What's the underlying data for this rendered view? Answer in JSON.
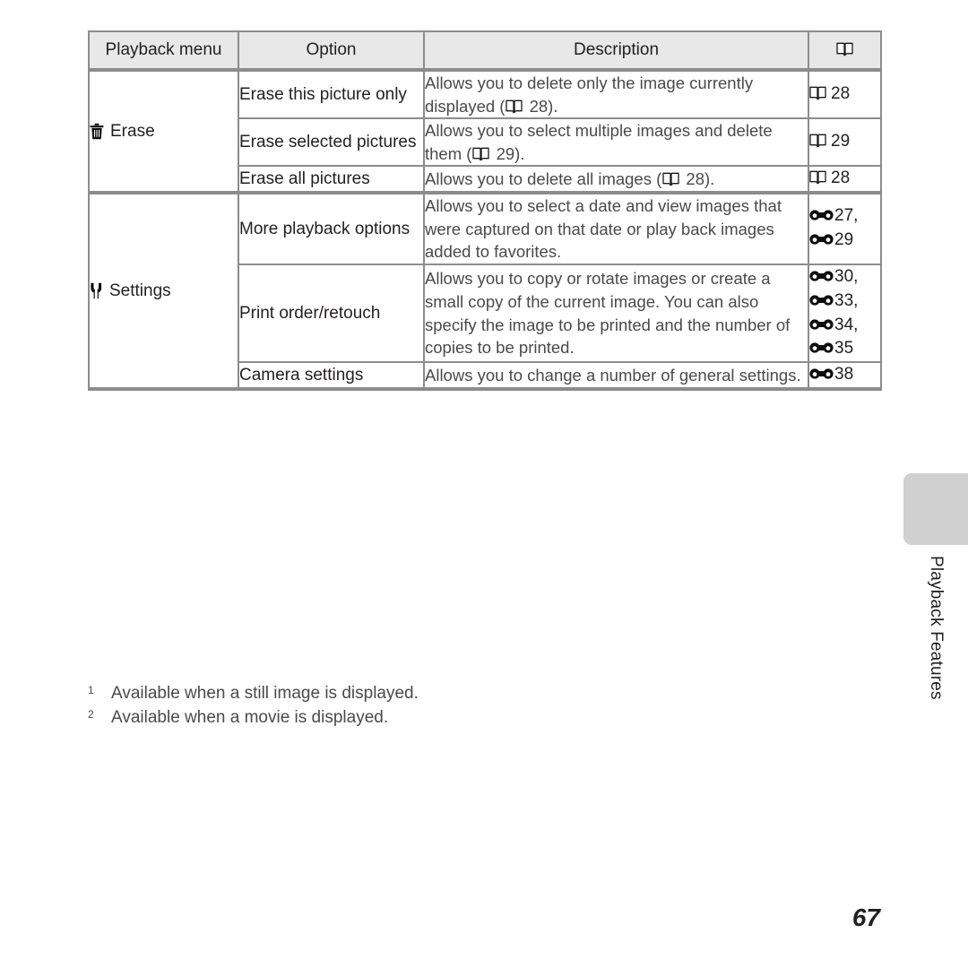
{
  "page": {
    "number": "67",
    "side_tab_label": "Playback Features"
  },
  "table": {
    "headers": {
      "menu": "Playback menu",
      "option": "Option",
      "description": "Description",
      "reference_icon": "book-icon"
    },
    "sections": [
      {
        "menu_label": "Erase",
        "menu_icon": "trash-icon",
        "rows": [
          {
            "option": "Erase this picture only",
            "description_before": "Allows you to delete only the image currently displayed (",
            "description_icon": "book-icon",
            "description_mid": "28).",
            "description_after": "",
            "ref_icon": "book-icon",
            "ref_lines": [
              "28"
            ]
          },
          {
            "option": "Erase selected pictures",
            "description_before": "Allows you to select multiple images and delete them (",
            "description_icon": "book-icon",
            "description_mid": "29).",
            "description_after": "",
            "ref_icon": "book-icon",
            "ref_lines": [
              "29"
            ]
          },
          {
            "option": "Erase all pictures",
            "description_before": "Allows you to delete all images (",
            "description_icon": "book-icon",
            "description_mid": "28).",
            "description_after": "",
            "ref_icon": "book-icon",
            "ref_lines": [
              "28"
            ]
          }
        ]
      },
      {
        "menu_label": "Settings",
        "menu_icon": "wrench-icon",
        "rows": [
          {
            "option": "More playback options",
            "description_before": "Allows you to select a date and view images that were captured on that date or play back images added to favorites.",
            "description_icon": "",
            "description_mid": "",
            "description_after": "",
            "ref_icon": "reference-icon",
            "ref_lines": [
              "27,",
              "29"
            ]
          },
          {
            "option": "Print order/retouch",
            "description_before": "Allows you to copy or rotate images or create a small copy of the current image. You can also specify the image to be printed and the number of copies to be printed.",
            "description_icon": "",
            "description_mid": "",
            "description_after": "",
            "ref_icon": "reference-icon",
            "ref_lines": [
              "30,",
              "33,",
              "34,",
              "35"
            ]
          },
          {
            "option": "Camera settings",
            "description_before": "Allows you to change a number of general settings.",
            "description_icon": "",
            "description_mid": "",
            "description_after": "",
            "ref_icon": "reference-icon",
            "ref_lines": [
              "38"
            ]
          }
        ]
      }
    ]
  },
  "footnotes": [
    {
      "mark": "1",
      "text": "Available when a still image is displayed."
    },
    {
      "mark": "2",
      "text": "Available when a movie is displayed."
    }
  ],
  "colors": {
    "header_background": "#e8e8e8",
    "border": "#8c8c8c",
    "text": "#231f20",
    "description_text": "#4a4a4a",
    "side_tab": "#d0d0d0"
  }
}
